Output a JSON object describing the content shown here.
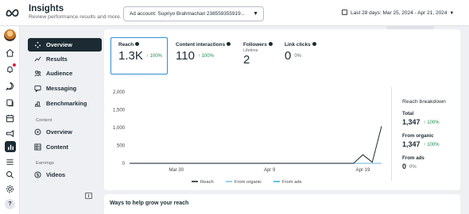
{
  "header": {
    "title": "Insights",
    "subtitle": "Review performance results and more.",
    "account": "Ad account: Supriyo Brahmachari 238559355919...",
    "date_range": "Last 28 days: Mar 25, 2024 - Apr 21, 2024"
  },
  "rail": {
    "icons": [
      "meta-logo",
      "avatar",
      "home-icon",
      "notifications-icon",
      "messages-icon",
      "pages-icon",
      "calendar-icon",
      "ads-icon",
      "insights-icon",
      "menu-icon",
      "search-icon",
      "settings-icon",
      "help-icon"
    ],
    "help_label": "?"
  },
  "nav": {
    "items": [
      {
        "label": "Overview",
        "icon": "overview-icon",
        "active": true
      },
      {
        "label": "Results",
        "icon": "results-icon"
      },
      {
        "label": "Audience",
        "icon": "audience-icon"
      },
      {
        "label": "Messaging",
        "icon": "messaging-icon"
      },
      {
        "label": "Benchmarking",
        "icon": "benchmarking-icon"
      }
    ],
    "content_section": "Content",
    "content_items": [
      {
        "label": "Overview",
        "icon": "content-overview-icon"
      },
      {
        "label": "Content",
        "icon": "content-grid-icon"
      }
    ],
    "earnings_section": "Earnings",
    "earnings_items": [
      {
        "label": "Videos",
        "icon": "dollar-icon"
      }
    ]
  },
  "metrics": [
    {
      "title": "Reach",
      "value": "1.3K",
      "delta": "↑ 100%",
      "selected": true
    },
    {
      "title": "Content interactions",
      "value": "110",
      "delta": "↑ 100%"
    },
    {
      "title": "Followers",
      "sub": "Lifetime",
      "value": "2",
      "delta": ""
    },
    {
      "title": "Link clicks",
      "value": "0",
      "delta": "0%"
    }
  ],
  "chart_data": {
    "type": "line",
    "x": [
      "Mar 25",
      "Mar 26",
      "Mar 27",
      "Mar 28",
      "Mar 29",
      "Mar 30",
      "Mar 31",
      "Apr 1",
      "Apr 2",
      "Apr 3",
      "Apr 4",
      "Apr 5",
      "Apr 6",
      "Apr 7",
      "Apr 8",
      "Apr 9",
      "Apr 10",
      "Apr 11",
      "Apr 12",
      "Apr 13",
      "Apr 14",
      "Apr 15",
      "Apr 16",
      "Apr 17",
      "Apr 18",
      "Apr 19",
      "Apr 20",
      "Apr 21"
    ],
    "x_tick_labels": [
      "Mar 30",
      "Apr 9",
      "Apr 19"
    ],
    "y_tick_labels": [
      "0",
      "500",
      "1,000",
      "1,500",
      "2,000"
    ],
    "ylim": [
      0,
      2000
    ],
    "series": [
      {
        "name": "Reach",
        "color": "#1c2b33",
        "values": [
          0,
          0,
          0,
          0,
          0,
          0,
          0,
          0,
          0,
          0,
          0,
          0,
          0,
          0,
          0,
          0,
          0,
          0,
          0,
          0,
          0,
          0,
          0,
          0,
          0,
          240,
          30,
          1040
        ]
      },
      {
        "name": "From organic",
        "color": "#7cc4ea",
        "values": [
          0,
          0,
          0,
          0,
          0,
          0,
          0,
          0,
          0,
          0,
          0,
          0,
          0,
          0,
          0,
          0,
          0,
          0,
          0,
          0,
          0,
          0,
          0,
          0,
          0,
          0,
          0,
          0
        ]
      },
      {
        "name": "From ads",
        "color": "#36b3d8",
        "values": [
          0,
          0,
          0,
          0,
          0,
          0,
          0,
          0,
          0,
          0,
          0,
          0,
          0,
          0,
          0,
          0,
          0,
          0,
          0,
          0,
          0,
          0,
          0,
          0,
          0,
          0,
          0,
          0
        ]
      }
    ],
    "legend_position": "bottom",
    "grid": false
  },
  "breakdown": {
    "title": "Reach breakdown",
    "total_label": "Total",
    "total_value": "1,347",
    "total_delta": "↑ 100%",
    "organic_label": "From organic",
    "organic_value": "1,347",
    "organic_delta": "↑ 100%",
    "ads_label": "From ads",
    "ads_value": "0",
    "ads_delta": "0%"
  },
  "grow": {
    "title": "Ways to help grow your reach"
  }
}
